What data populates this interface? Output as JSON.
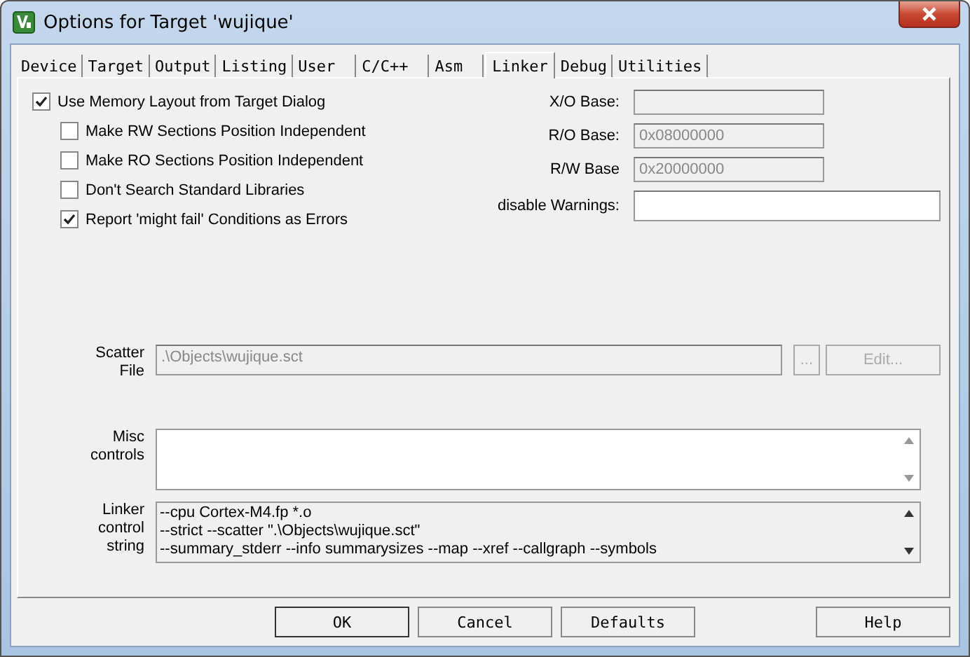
{
  "window": {
    "title": "Options for Target 'wujique'"
  },
  "tabs": [
    {
      "label": "Device",
      "selected": false
    },
    {
      "label": "Target",
      "selected": false
    },
    {
      "label": "Output",
      "selected": false
    },
    {
      "label": "Listing",
      "selected": false
    },
    {
      "label": "User",
      "selected": false
    },
    {
      "label": "C/C++",
      "selected": false
    },
    {
      "label": "Asm",
      "selected": false
    },
    {
      "label": "Linker",
      "selected": true
    },
    {
      "label": "Debug",
      "selected": false
    },
    {
      "label": "Utilities",
      "selected": false
    }
  ],
  "options": [
    {
      "label": "Use Memory Layout from Target Dialog",
      "checked": true,
      "children": [
        {
          "label": "Make RW Sections Position Independent",
          "checked": false
        },
        {
          "label": "Make RO Sections Position Independent",
          "checked": false
        },
        {
          "label": "Don't Search Standard Libraries",
          "checked": false
        },
        {
          "label": "Report 'might fail' Conditions as Errors",
          "checked": true
        }
      ]
    }
  ],
  "bases": [
    {
      "label": "X/O Base:",
      "disabled": true
    },
    {
      "label": "R/O Base:",
      "value": "0x08000000",
      "disabled": true
    },
    {
      "label": "R/W Base",
      "value": "0x20000000",
      "disabled": true
    },
    {
      "label": "disable Warnings:",
      "disabled": false
    }
  ],
  "scatter": {
    "label": "Scatter File",
    "value": ".\\Objects\\wujique.sct",
    "disabled": true,
    "browse": {
      "label": "...",
      "disabled": true
    },
    "edit": {
      "label": "Edit...",
      "disabled": true
    }
  },
  "misc": {
    "label": "Misc controls",
    "disabled": false
  },
  "linker": {
    "label": "Linker control string",
    "lines": [
      "--cpu Cortex-M4.fp *.o",
      "--strict --scatter \".\\Objects\\wujique.sct\"",
      "--summary_stderr --info summarysizes --map --xref --callgraph --symbols"
    ],
    "disabled": true
  },
  "buttons": [
    {
      "label": "OK",
      "kind": "default"
    },
    {
      "label": "Cancel",
      "kind": "normal"
    },
    {
      "label": "Defaults",
      "kind": "normal"
    },
    {
      "label": "Help",
      "kind": "help"
    }
  ]
}
